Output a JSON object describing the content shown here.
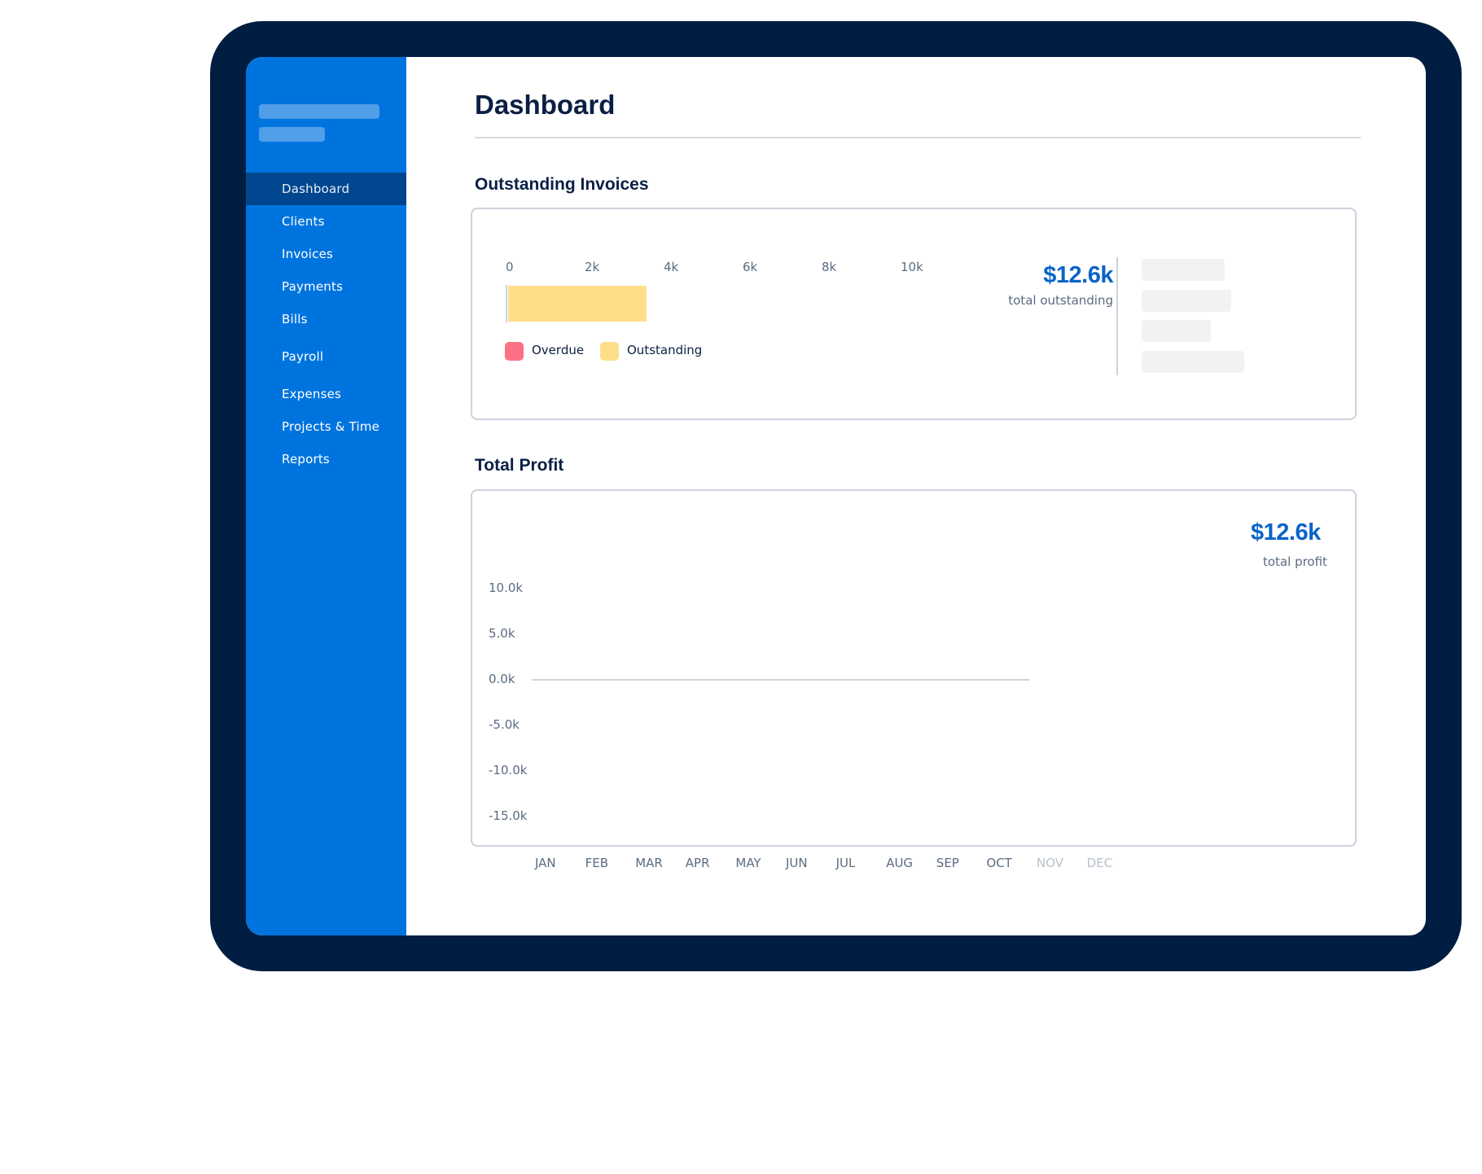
{
  "colors": {
    "device_frame": "#001D42",
    "sidebar": "#0074DE",
    "sidebar_active": "#00478F",
    "accent_text": "#0A63C9",
    "overdue": "#FA7185",
    "outstanding": "#FFDE8A",
    "future_month": "#B8C0CC"
  },
  "sidebar": {
    "items": [
      {
        "label": "Dashboard",
        "active": true
      },
      {
        "label": "Clients",
        "active": false
      },
      {
        "label": "Invoices",
        "active": false
      },
      {
        "label": "Payments",
        "active": false
      },
      {
        "label": "Bills",
        "active": false
      },
      {
        "label": "Payroll",
        "active": false
      },
      {
        "label": "Expenses",
        "active": false
      },
      {
        "label": "Projects & Time",
        "active": false
      },
      {
        "label": "Reports",
        "active": false
      }
    ]
  },
  "header": {
    "title": "Dashboard"
  },
  "outstanding_invoices": {
    "title": "Outstanding Invoices",
    "total_value": "$12.6k",
    "total_label": "total outstanding"
  },
  "total_profit": {
    "title": "Total Profit",
    "total_value": "$12.6k",
    "total_label": "total profit"
  },
  "chart_data": [
    {
      "type": "bar",
      "orientation": "horizontal",
      "stacked": true,
      "title": "Outstanding Invoices",
      "x_ticks": [
        "0",
        "2k",
        "4k",
        "6k",
        "8k",
        "10k"
      ],
      "xlim": [
        0,
        10000
      ],
      "series": [
        {
          "name": "Overdue",
          "color": "#FA7185",
          "values": [
            0
          ]
        },
        {
          "name": "Outstanding",
          "color": "#FFDE8A",
          "values": [
            3500
          ]
        }
      ],
      "legend": [
        "Overdue",
        "Outstanding"
      ],
      "legend_position": "bottom-left"
    },
    {
      "type": "line",
      "title": "Total Profit",
      "y_ticks": [
        "10.0k",
        "5.0k",
        "0.0k",
        "-5.0k",
        "-10.0k",
        "-15.0k"
      ],
      "ylim": [
        -15000,
        10000
      ],
      "categories": [
        "JAN",
        "FEB",
        "MAR",
        "APR",
        "MAY",
        "JUN",
        "JUL",
        "AUG",
        "SEP",
        "OCT",
        "NOV",
        "DEC"
      ],
      "future_categories": [
        "NOV",
        "DEC"
      ],
      "series": [
        {
          "name": "Profit",
          "values": [
            0,
            0,
            0,
            0,
            0,
            0,
            0,
            0,
            0,
            0
          ]
        }
      ]
    }
  ]
}
